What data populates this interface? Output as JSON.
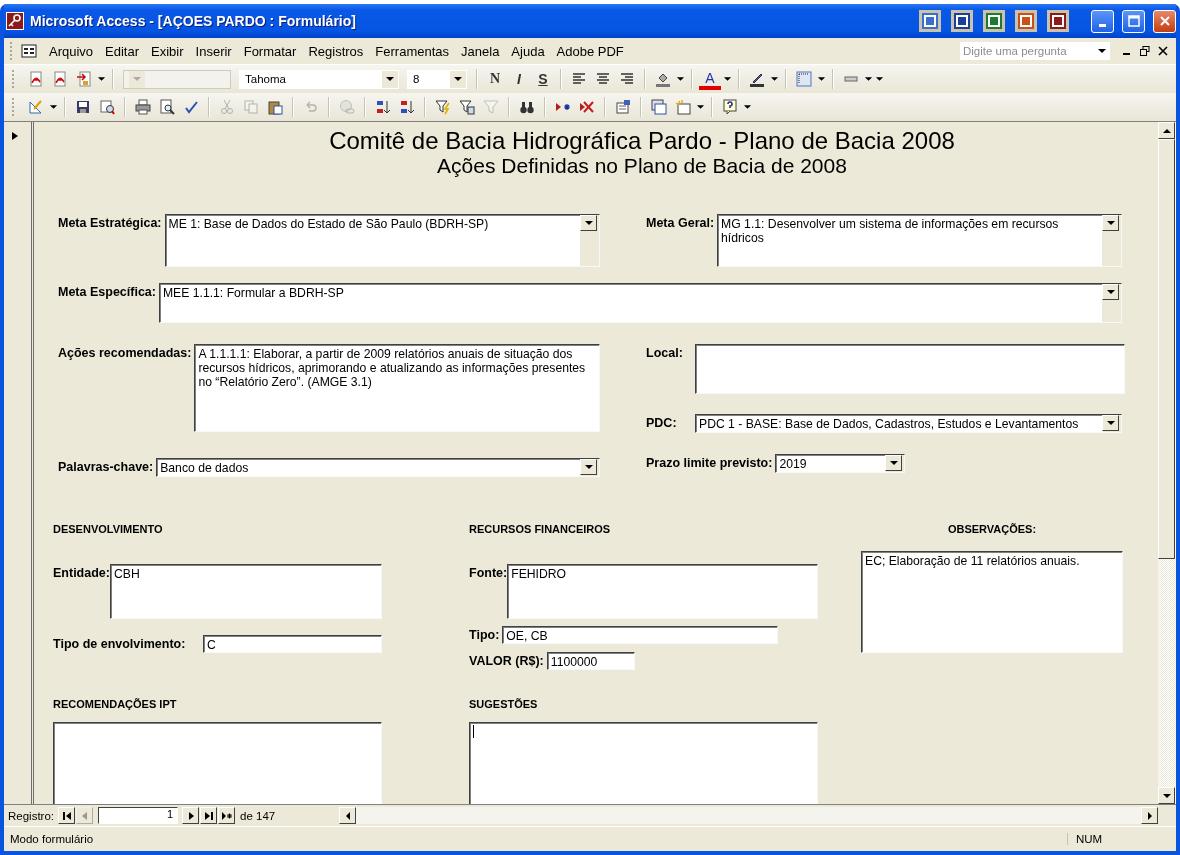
{
  "window": {
    "title": "Microsoft Access - [AÇOES PARDO : Formulário]"
  },
  "menu": [
    "Arquivo",
    "Editar",
    "Exibir",
    "Inserir",
    "Formatar",
    "Registros",
    "Ferramentas",
    "Janela",
    "Ajuda",
    "Adobe PDF"
  ],
  "help_search": {
    "placeholder": "Digite uma pergunta"
  },
  "formatting_toolbar": [
    {
      "kind": "pdf",
      "disabled": false
    },
    {
      "kind": "pdf",
      "disabled": false
    },
    {
      "kind": "pdf-convert",
      "disabled": false
    },
    {
      "kind": "more",
      "disabled": false
    },
    {
      "kind": "separator"
    },
    {
      "kind": "object-combo",
      "disabled": true
    },
    {
      "kind": "font-combo",
      "value": "Tahoma",
      "disabled": false
    },
    {
      "kind": "size-combo",
      "value": "8",
      "disabled": false
    },
    {
      "kind": "separator"
    },
    {
      "kind": "bold",
      "text": "N",
      "disabled": false
    },
    {
      "kind": "italic",
      "text": "I",
      "disabled": false
    },
    {
      "kind": "underline",
      "text": "S",
      "disabled": false
    },
    {
      "kind": "separator"
    },
    {
      "kind": "align-left",
      "disabled": false
    },
    {
      "kind": "align-center",
      "disabled": false
    },
    {
      "kind": "align-right",
      "disabled": false
    },
    {
      "kind": "separator"
    },
    {
      "kind": "fill-color",
      "disabled": false
    },
    {
      "kind": "dropdown",
      "disabled": false
    },
    {
      "kind": "separator"
    },
    {
      "kind": "font-color",
      "text": "A",
      "disabled": false
    },
    {
      "kind": "dropdown",
      "disabled": false
    },
    {
      "kind": "separator"
    },
    {
      "kind": "line-color",
      "disabled": false
    },
    {
      "kind": "dropdown",
      "disabled": false
    },
    {
      "kind": "separator"
    },
    {
      "kind": "border",
      "disabled": false
    },
    {
      "kind": "dropdown",
      "disabled": false
    },
    {
      "kind": "separator"
    },
    {
      "kind": "line-style",
      "disabled": false
    },
    {
      "kind": "dropdown",
      "disabled": false
    },
    {
      "kind": "more",
      "disabled": false
    }
  ],
  "form_toolbar": [
    {
      "kind": "design",
      "disabled": false
    },
    {
      "kind": "dropdown",
      "disabled": false
    },
    {
      "kind": "separator"
    },
    {
      "kind": "save",
      "disabled": false
    },
    {
      "kind": "web-preview",
      "disabled": false
    },
    {
      "kind": "separator"
    },
    {
      "kind": "print",
      "disabled": false
    },
    {
      "kind": "print-preview",
      "disabled": false
    },
    {
      "kind": "spelling",
      "disabled": false
    },
    {
      "kind": "separator"
    },
    {
      "kind": "cut",
      "disabled": true
    },
    {
      "kind": "copy",
      "disabled": true
    },
    {
      "kind": "paste",
      "disabled": false
    },
    {
      "kind": "separator"
    },
    {
      "kind": "undo",
      "disabled": true
    },
    {
      "kind": "separator"
    },
    {
      "kind": "hyperlink",
      "disabled": true
    },
    {
      "kind": "separator"
    },
    {
      "kind": "sort-ascending",
      "disabled": false
    },
    {
      "kind": "sort-descending",
      "disabled": false
    },
    {
      "kind": "separator"
    },
    {
      "kind": "filter-selection",
      "disabled": false
    },
    {
      "kind": "filter-form",
      "disabled": false
    },
    {
      "kind": "filter",
      "disabled": true
    },
    {
      "kind": "separator"
    },
    {
      "kind": "find",
      "disabled": false
    },
    {
      "kind": "separator"
    },
    {
      "kind": "new-record",
      "disabled": false
    },
    {
      "kind": "delete-record",
      "disabled": false
    },
    {
      "kind": "separator"
    },
    {
      "kind": "properties",
      "disabled": false
    },
    {
      "kind": "separator"
    },
    {
      "kind": "database-window",
      "disabled": false
    },
    {
      "kind": "new-object",
      "disabled": false
    },
    {
      "kind": "dropdown",
      "disabled": false
    },
    {
      "kind": "separator"
    },
    {
      "kind": "help",
      "disabled": false
    },
    {
      "kind": "more",
      "disabled": false
    }
  ],
  "form": {
    "title": "Comitê de Bacia Hidrográfica Pardo - Plano de Bacia 2008",
    "subtitle": "Ações Definidas no Plano de Bacia de 2008",
    "meta_estrategica": {
      "label": "Meta Estratégica:",
      "value": "ME 1: Base de Dados do Estado de São Paulo (BDRH-SP)"
    },
    "meta_geral": {
      "label": "Meta Geral:",
      "value": "MG 1.1:  Desenvolver um sistema de informações em recursos hídricos"
    },
    "meta_especifica": {
      "label": "Meta Específica:",
      "value": "MEE 1.1.1: Formular a BDRH-SP"
    },
    "acoes_recomendadas": {
      "label": "Ações recomendadas:",
      "value": "A 1.1.1.1: Elaborar, a partir de 2009 relatórios anuais de situação dos recursos hídricos, aprimorando e atualizando as informações presentes no “Relatório Zero”. (AMGE 3.1)"
    },
    "local": {
      "label": "Local:"
    },
    "pdc": {
      "label": "PDC:",
      "value": "PDC 1 - BASE: Base de Dados, Cadastros, Estudos e Levantamentos"
    },
    "palavras_chave": {
      "label": "Palavras-chave:",
      "value": "Banco de dados"
    },
    "prazo": {
      "label": "Prazo limite previsto:",
      "value": "2019"
    },
    "desenvolvimento": {
      "heading": "DESENVOLVIMENTO",
      "entidade": {
        "label": "Entidade:",
        "value": "CBH"
      },
      "tipo_envolvimento": {
        "label": "Tipo de envolvimento:",
        "value": "C"
      }
    },
    "recursos": {
      "heading": "RECURSOS FINANCEIROS",
      "fonte": {
        "label": "Fonte:",
        "value": "FEHIDRO"
      },
      "tipo": {
        "label": "Tipo:",
        "value": "OE, CB"
      },
      "valor": {
        "label": "VALOR (R$):",
        "value": "1100000"
      }
    },
    "observacoes": {
      "heading": "OBSERVAÇÕES:",
      "value": "EC; Elaboração de 11 relatórios anuais."
    },
    "recomendacoes_ipt": {
      "heading": "RECOMENDAÇÕES IPT"
    },
    "sugestoes": {
      "heading": "SUGESTÕES",
      "focused": true
    }
  },
  "record_nav": {
    "label": "Registro:",
    "current": "1",
    "total": "de 147",
    "buttons": [
      {
        "kind": "first",
        "disabled": false
      },
      {
        "kind": "prev",
        "disabled": true
      },
      {
        "kind": "next",
        "disabled": false
      },
      {
        "kind": "last",
        "disabled": false
      },
      {
        "kind": "new",
        "disabled": false
      }
    ]
  },
  "status_bar": {
    "mode": "Modo formulário",
    "indicator": "NUM"
  }
}
